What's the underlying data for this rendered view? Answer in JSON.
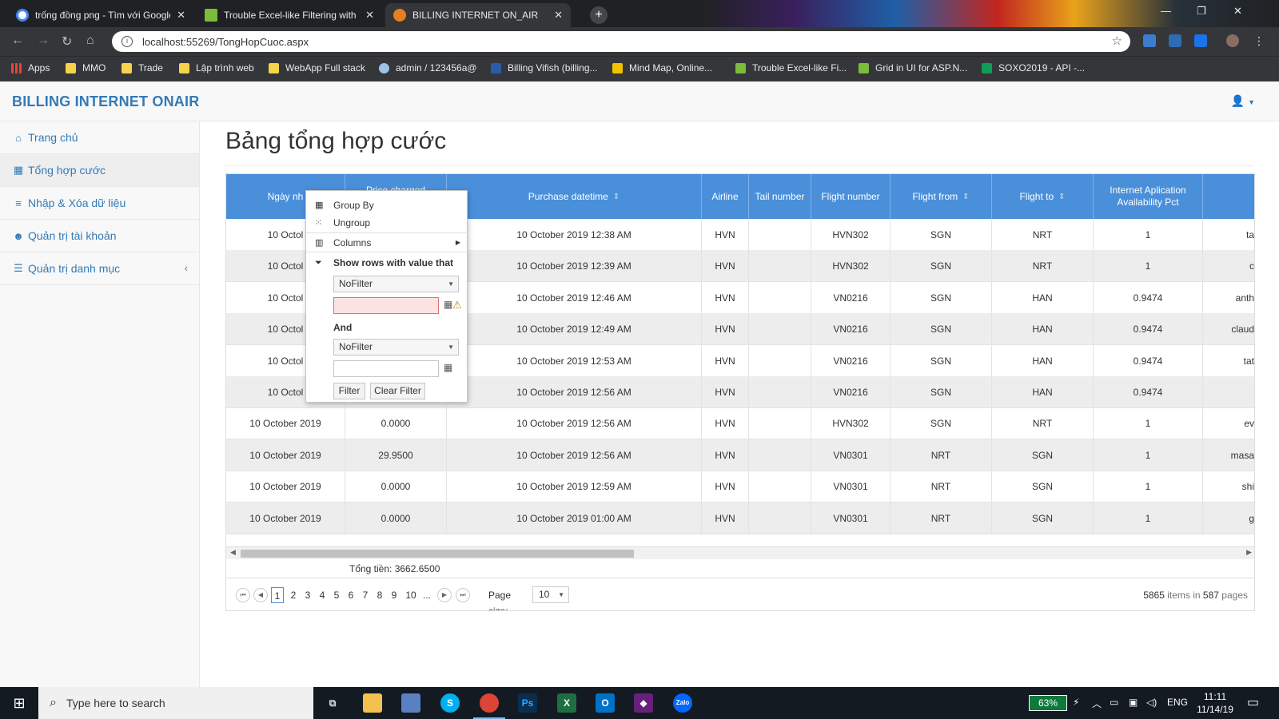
{
  "browser": {
    "tabs": [
      {
        "title": "trống đồng png - Tìm với Google"
      },
      {
        "title": "Trouble Excel-like Filtering with G"
      },
      {
        "title": "BILLING INTERNET ON_AIR"
      }
    ],
    "url": "localhost:55269/TongHopCuoc.aspx",
    "bookmarks": [
      "Apps",
      "MMO",
      "Trade",
      "Lập trình web",
      "WebApp Full stack",
      "admin / 123456a@",
      "Billing Vifish (billing...",
      "Mind Map, Online...",
      "Trouble Excel-like Fi...",
      "Grid in UI for ASP.N...",
      "SOXO2019 - API -..."
    ]
  },
  "app": {
    "brand": "BILLING INTERNET ONAIR"
  },
  "sidebar": {
    "items": [
      {
        "label": "Trang chủ",
        "icon": "home-icon"
      },
      {
        "label": "Tổng hợp cước",
        "icon": "grid-icon"
      },
      {
        "label": "Nhập & Xóa dữ liệu",
        "icon": "database-icon"
      },
      {
        "label": "Quản trị tài khoản",
        "icon": "users-icon"
      },
      {
        "label": "Quản trị danh mục",
        "icon": "list-icon"
      }
    ]
  },
  "page": {
    "title": "Bảng tổng hợp cước"
  },
  "grid": {
    "headers": [
      "Ngày nh",
      "Price charged amount",
      "Purchase datetime",
      "Airline",
      "Tail number",
      "Flight number",
      "Flight from",
      "Flight to",
      "Internet Aplication Availability Pct",
      ""
    ],
    "rows": [
      [
        "10 Octol",
        "",
        "10 October 2019 12:38 AM",
        "HVN",
        "",
        "HVN302",
        "SGN",
        "NRT",
        "1",
        "ta"
      ],
      [
        "10 Octol",
        "",
        "10 October 2019 12:39 AM",
        "HVN",
        "",
        "HVN302",
        "SGN",
        "NRT",
        "1",
        "c"
      ],
      [
        "10 Octol",
        "",
        "10 October 2019 12:46 AM",
        "HVN",
        "",
        "VN0216",
        "SGN",
        "HAN",
        "0.9474",
        "anth"
      ],
      [
        "10 Octol",
        "",
        "10 October 2019 12:49 AM",
        "HVN",
        "",
        "VN0216",
        "SGN",
        "HAN",
        "0.9474",
        "claud"
      ],
      [
        "10 Octol",
        "",
        "10 October 2019 12:53 AM",
        "HVN",
        "",
        "VN0216",
        "SGN",
        "HAN",
        "0.9474",
        "tat"
      ],
      [
        "10 Octol",
        "",
        "10 October 2019 12:56 AM",
        "HVN",
        "",
        "VN0216",
        "SGN",
        "HAN",
        "0.9474",
        ""
      ],
      [
        "10 October 2019",
        "0.0000",
        "10 October 2019 12:56 AM",
        "HVN",
        "",
        "HVN302",
        "SGN",
        "NRT",
        "1",
        "ev"
      ],
      [
        "10 October 2019",
        "29.9500",
        "10 October 2019 12:56 AM",
        "HVN",
        "",
        "VN0301",
        "NRT",
        "SGN",
        "1",
        "masa"
      ],
      [
        "10 October 2019",
        "0.0000",
        "10 October 2019 12:59 AM",
        "HVN",
        "",
        "VN0301",
        "NRT",
        "SGN",
        "1",
        "shi"
      ],
      [
        "10 October 2019",
        "0.0000",
        "10 October 2019 01:00 AM",
        "HVN",
        "",
        "VN0301",
        "NRT",
        "SGN",
        "1",
        "g"
      ]
    ],
    "total_label": "Tổng tiền: 3662.6500",
    "pager": {
      "pages": [
        "1",
        "2",
        "3",
        "4",
        "5",
        "6",
        "7",
        "8",
        "9",
        "10",
        "..."
      ],
      "page_size_label": "Page size:",
      "page_size": "10",
      "total_items": "5865",
      "items_in": "items in",
      "total_pages": "587",
      "pages_word": "pages"
    }
  },
  "column_menu": {
    "group_by": "Group By",
    "ungroup": "Ungroup",
    "columns": "Columns",
    "show_rows": "Show rows with value that",
    "operator1": "NoFilter",
    "logic": "And",
    "operator2": "NoFilter",
    "filter_button": "Filter",
    "clear_button": "Clear Filter"
  },
  "taskbar": {
    "search_placeholder": "Type here to search",
    "battery": "63%",
    "language": "ENG",
    "time": "11:11",
    "date": "11/14/19"
  }
}
